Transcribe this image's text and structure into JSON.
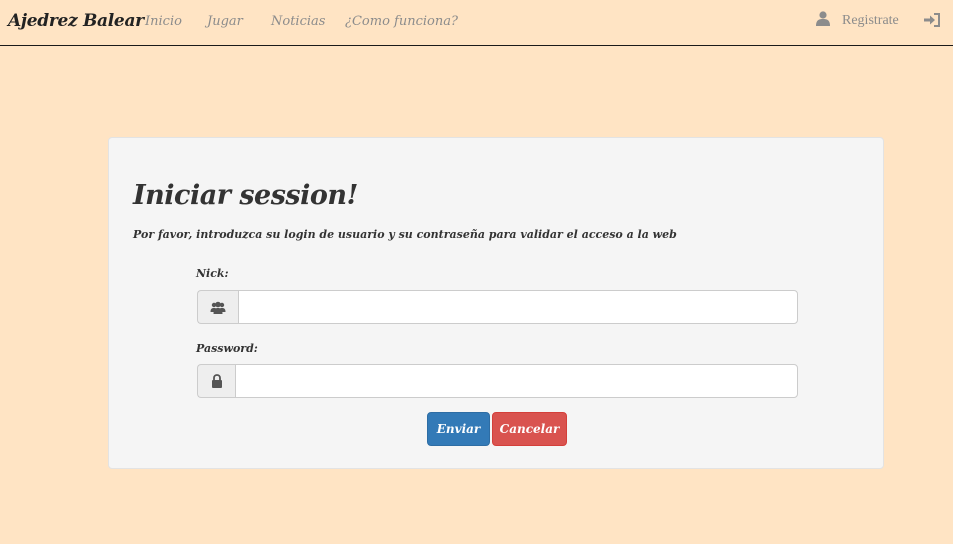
{
  "navbar": {
    "brand": "Ajedrez Balear",
    "links": [
      "Inicio",
      "Jugar",
      "Noticias",
      "¿Como funciona?"
    ],
    "register_label": "Registrate",
    "register_icon": "user-icon",
    "login_icon": "log-in-icon"
  },
  "login": {
    "title": "Iniciar session!",
    "subtitle": "Por favor, introduzca su login de usuario y su contraseña para validar el acceso a la web",
    "nick_label": "Nick:",
    "nick_icon": "users-icon",
    "nick_value": "",
    "password_label": "Password:",
    "password_icon": "lock-icon",
    "password_value": "",
    "submit_label": "Enviar",
    "cancel_label": "Cancelar"
  },
  "colors": {
    "page_background": "#ffe4c4",
    "panel_background": "#f5f5f5",
    "primary": "#337ab7",
    "danger": "#d9534f",
    "nav_text": "#8c8c8c"
  }
}
